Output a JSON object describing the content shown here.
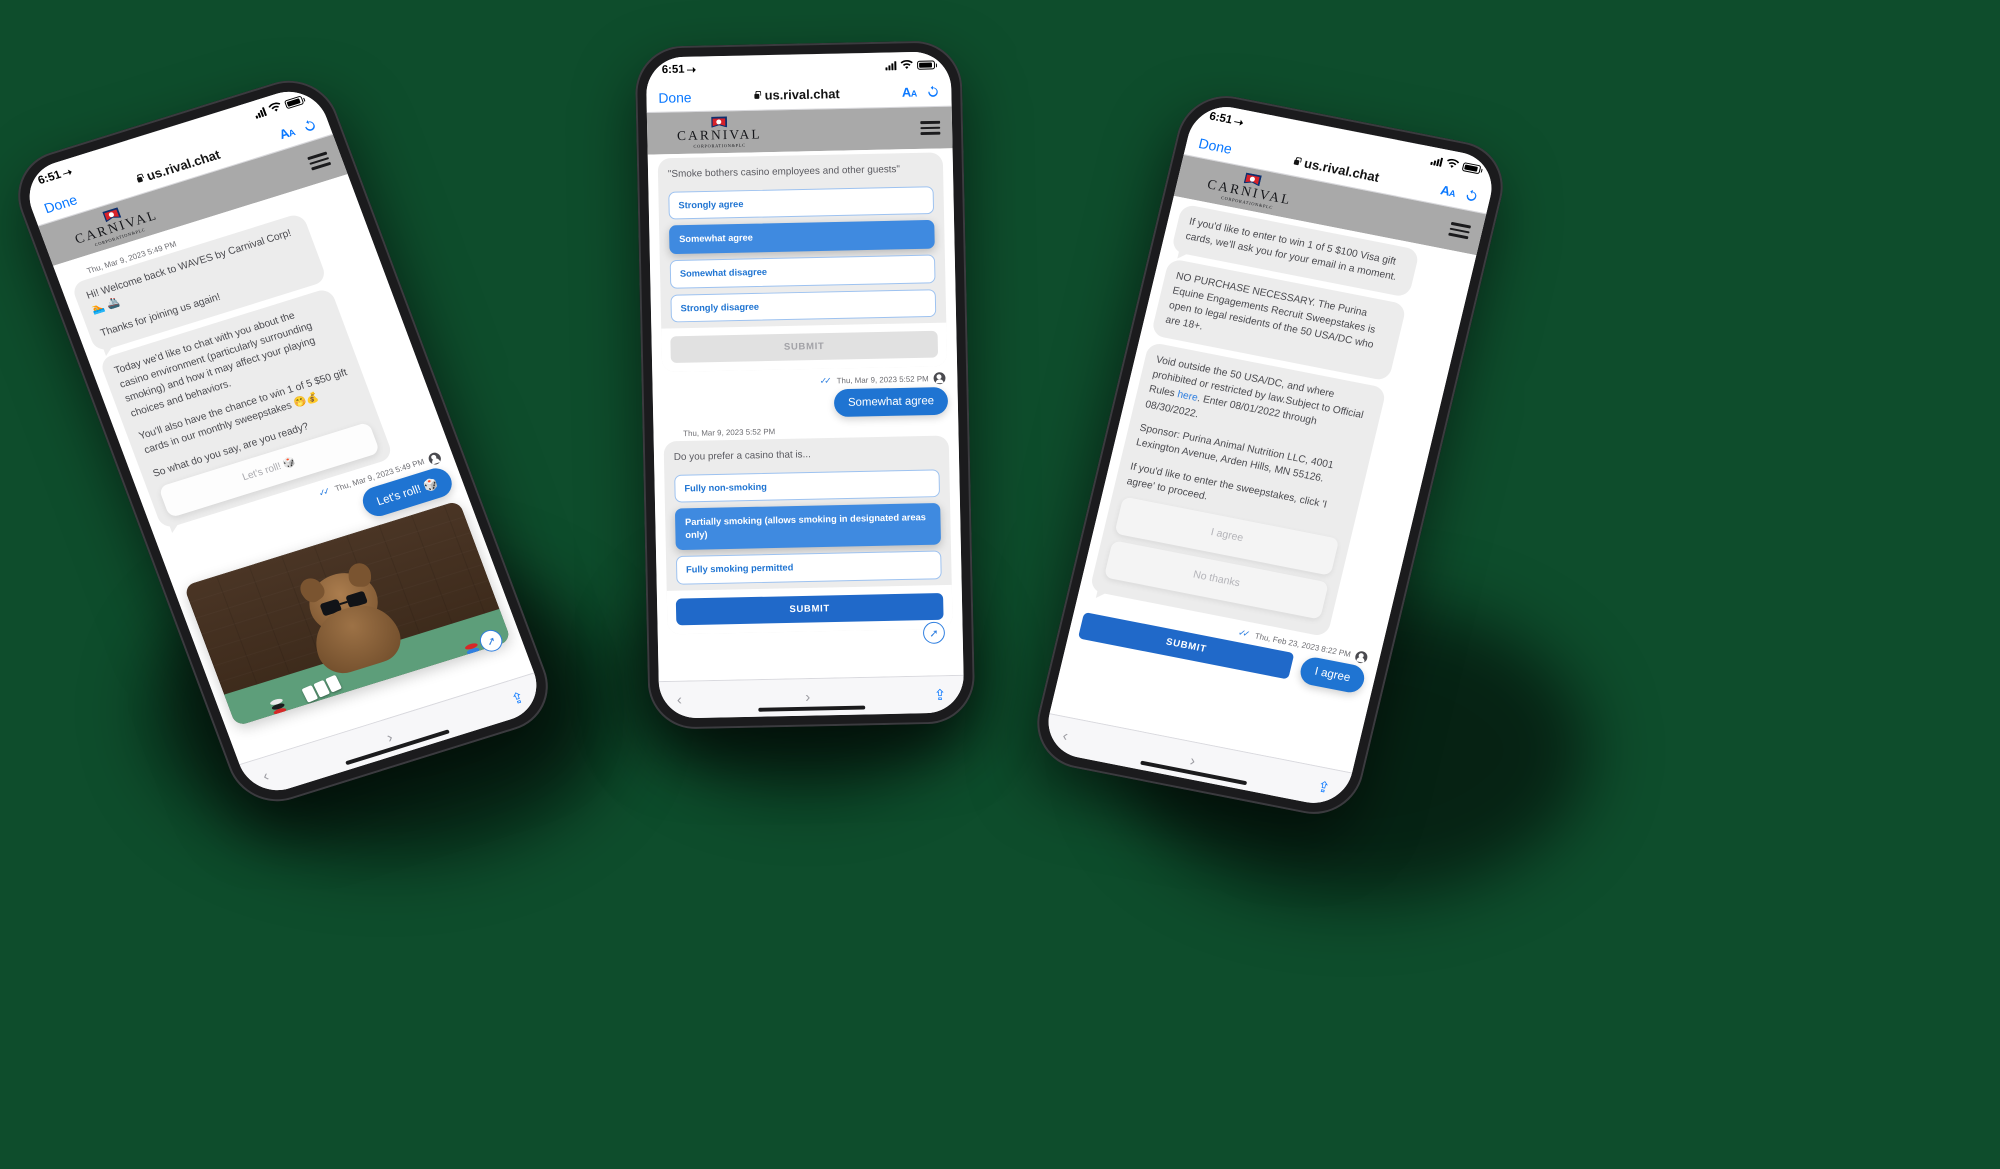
{
  "background_color": "#0e4d2c",
  "accent_blue": "#2069c9",
  "brand": {
    "name": "CARNIVAL",
    "subtitle": "CORPORATION&PLC",
    "logo_icon": "carnival-flag-icon"
  },
  "phones": [
    {
      "id": "left",
      "status": {
        "time": "6:51",
        "location_icon": "location-arrow-icon",
        "signal_icon": "cellular-bars-icon",
        "wifi_icon": "wifi-icon",
        "battery_icon": "battery-icon"
      },
      "safari": {
        "done_label": "Done",
        "url": "us.rival.chat",
        "lock_icon": "lock-icon",
        "text_size_label": "AA",
        "reload_icon": "reload-icon"
      },
      "menu_icon": "hamburger-menu-icon",
      "messages": [
        {
          "kind": "meta",
          "avatar": "carnival-flag-icon",
          "text": "Thu, Mar 9, 2023 5:49 PM"
        },
        {
          "kind": "bot",
          "paragraphs": [
            "Hi! Welcome back to WAVES by Carnival Corp! 🏊 🚢",
            "Thanks for joining us again!"
          ]
        },
        {
          "kind": "bot",
          "paragraphs": [
            "Today we'd like to chat with you about the casino environment (particularly surrounding smoking) and how it may affect your playing choices and behaviors.",
            "You'll also have the chance to win 1 of 5 $50 gift cards in our monthly sweepstakes 🤭💰",
            "So what do you say, are you ready?"
          ],
          "ghost_button": "Let's roll! 🎲"
        },
        {
          "kind": "meta-right",
          "checks_icon": "double-check-icon",
          "text": "Thu, Mar 9, 2023 5:49 PM",
          "avatar": "user-avatar-icon"
        },
        {
          "kind": "user",
          "text": "Let's roll! 🎲"
        },
        {
          "kind": "gif",
          "alt": "pomeranian-dog-with-sunglasses-at-poker-table"
        }
      ],
      "toolbar": {
        "back_icon": "chevron-left-icon",
        "forward_icon": "chevron-right-icon",
        "share_icon": "share-icon",
        "compass_icon": "compass-icon"
      }
    },
    {
      "id": "center",
      "status": {
        "time": "6:51",
        "location_icon": "location-arrow-icon",
        "signal_icon": "cellular-bars-icon",
        "wifi_icon": "wifi-icon",
        "battery_icon": "battery-icon"
      },
      "safari": {
        "done_label": "Done",
        "url": "us.rival.chat",
        "lock_icon": "lock-icon",
        "text_size_label": "AA",
        "reload_icon": "reload-icon"
      },
      "menu_icon": "hamburger-menu-icon",
      "question_1": {
        "prompt": "\"Smoke bothers casino employees and other guests\"",
        "options": [
          {
            "label": "Strongly agree",
            "selected": false
          },
          {
            "label": "Somewhat agree",
            "selected": true
          },
          {
            "label": "Somewhat disagree",
            "selected": false
          },
          {
            "label": "Strongly disagree",
            "selected": false
          }
        ],
        "submit_label": "SUBMIT",
        "submit_enabled": false
      },
      "reply_1": {
        "checks_icon": "double-check-icon",
        "timestamp": "Thu, Mar 9, 2023 5:52 PM",
        "avatar": "user-avatar-icon",
        "text": "Somewhat agree"
      },
      "question_2_meta": {
        "avatar": "carnival-flag-icon",
        "timestamp": "Thu, Mar 9, 2023 5:52 PM"
      },
      "question_2": {
        "prompt": "Do you prefer a casino that is...",
        "options": [
          {
            "label": "Fully non-smoking",
            "selected": false
          },
          {
            "label": "Partially smoking (allows smoking in designated areas only)",
            "selected": true
          },
          {
            "label": "Fully smoking permitted",
            "selected": false
          }
        ],
        "submit_label": "SUBMIT",
        "submit_enabled": true
      },
      "toolbar": {
        "back_icon": "chevron-left-icon",
        "forward_icon": "chevron-right-icon",
        "share_icon": "share-icon",
        "compass_icon": "compass-icon"
      }
    },
    {
      "id": "right",
      "status": {
        "time": "6:51",
        "location_icon": "location-arrow-icon",
        "signal_icon": "cellular-bars-icon",
        "wifi_icon": "wifi-icon",
        "battery_icon": "battery-icon"
      },
      "safari": {
        "done_label": "Done",
        "url": "us.rival.chat",
        "lock_icon": "lock-icon",
        "text_size_label": "AA",
        "reload_icon": "reload-icon"
      },
      "menu_icon": "hamburger-menu-icon",
      "messages": [
        {
          "kind": "bot",
          "paragraphs": [
            "If you'd like to enter to win 1 of 5 $100 Visa gift cards, we'll ask you for your email in a moment."
          ]
        },
        {
          "kind": "bot",
          "paragraphs": [
            "NO PURCHASE NECESSARY. The Purina Equine Engagements Recruit Sweepstakes is open to legal residents of the 50 USA/DC who are 18+."
          ]
        },
        {
          "kind": "bot-legal",
          "paragraphs": [
            "Void outside the 50 USA/DC, and where prohibited or restricted by law.Subject to Official Rules here. Enter 08/01/2022 through 08/30/2022.",
            "Sponsor: Purina Animal Nutrition LLC, 4001 Lexington Avenue, Arden Hills, MN 55126.",
            "If you'd like to enter the sweepstakes, click 'I agree' to proceed."
          ],
          "link_text": "here",
          "buttons": [
            "I agree",
            "No thanks"
          ]
        }
      ],
      "reply": {
        "checks_icon": "double-check-icon",
        "timestamp": "Thu, Feb 23, 2023 8:22 PM",
        "avatar": "user-avatar-icon",
        "text": "I agree"
      },
      "submit_label": "SUBMIT",
      "toolbar": {
        "back_icon": "chevron-left-icon",
        "forward_icon": "chevron-right-icon",
        "share_icon": "share-icon",
        "compass_icon": "compass-icon"
      }
    }
  ]
}
